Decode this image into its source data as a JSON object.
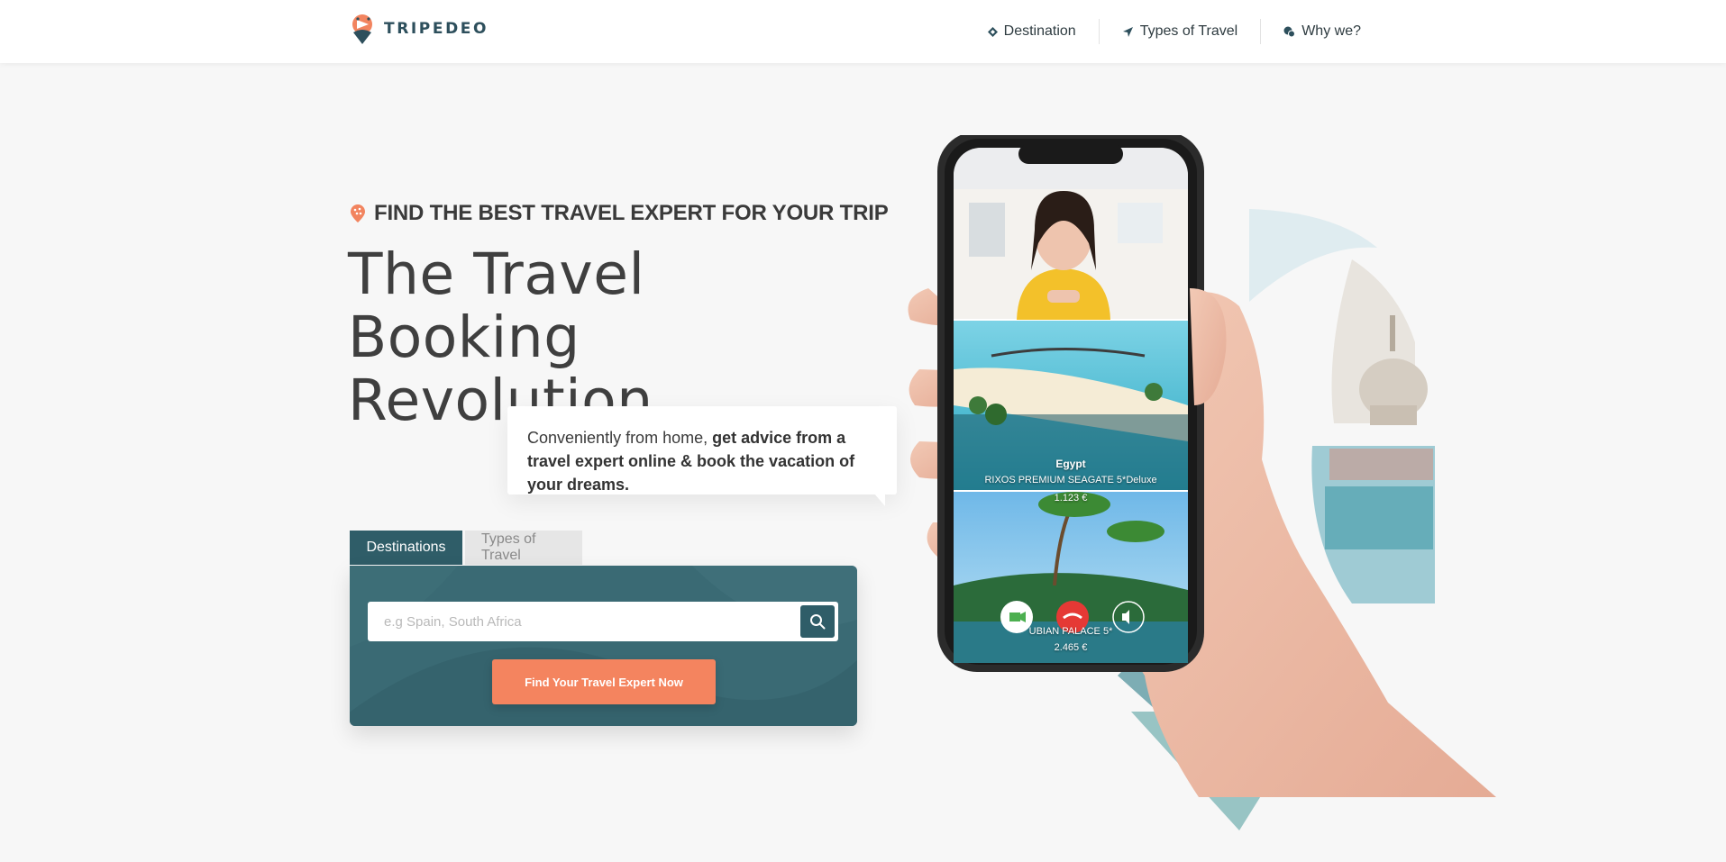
{
  "brand": {
    "name": "TRIPEDEO"
  },
  "nav": {
    "items": [
      {
        "label": "Destination",
        "icon": "diamond-icon"
      },
      {
        "label": "Types of Travel",
        "icon": "plane-icon"
      },
      {
        "label": "Why we?",
        "icon": "chat-icon"
      }
    ]
  },
  "hero": {
    "eyebrow": "FIND THE BEST TRAVEL EXPERT FOR YOUR TRIP",
    "headline_line1": "The Travel Booking",
    "headline_line2": "Revolution",
    "bubble_plain": "Conveniently from home, ",
    "bubble_bold": "get advice from a travel expert online & book the vacation of your dreams."
  },
  "search": {
    "tabs": [
      {
        "label": "Destinations",
        "active": true
      },
      {
        "label": "Types of Travel",
        "active": false
      }
    ],
    "placeholder": "e.g Spain, South Africa",
    "cta_label": "Find Your Travel Expert Now"
  },
  "phone": {
    "card1": {
      "country": "Egypt",
      "hotel": "RIXOS PREMIUM SEAGATE 5*Deluxe",
      "price": "1.123 €"
    },
    "card2": {
      "hotel": "UBIAN PALACE 5*",
      "price": "2.465 €"
    }
  },
  "colors": {
    "brand_teal": "#2f5d68",
    "accent_orange": "#f4845f",
    "call_red": "#e53935",
    "video_green": "#4caf50"
  }
}
